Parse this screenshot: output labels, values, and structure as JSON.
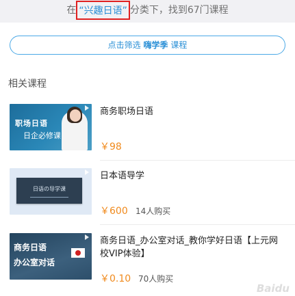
{
  "summary": {
    "prefix": "在",
    "keyword": "“兴趣日语”",
    "suffix": "分类下，找到67门课程"
  },
  "filter": {
    "prefix": "点击筛选",
    "brand": "嗨学季",
    "suffix": "课程"
  },
  "section_title": "相关课程",
  "courses": [
    {
      "title": "商务职场日语",
      "price": "￥98",
      "buyers": "",
      "thumb": {
        "line1": "职场日语",
        "line2": "日企必修课"
      }
    },
    {
      "title": "日本语导学",
      "price": "￥600",
      "buyers": "14人购买",
      "thumb": {
        "line1": "日语の导学课"
      }
    },
    {
      "title": "商务日语_办公室对话_教你学好日语【上元网校VIP体验】",
      "price": "￥0.10",
      "buyers": "70人购买",
      "thumb": {
        "line1": "商务日语",
        "line2": "办公室对话"
      }
    }
  ],
  "watermark": "Baidu"
}
